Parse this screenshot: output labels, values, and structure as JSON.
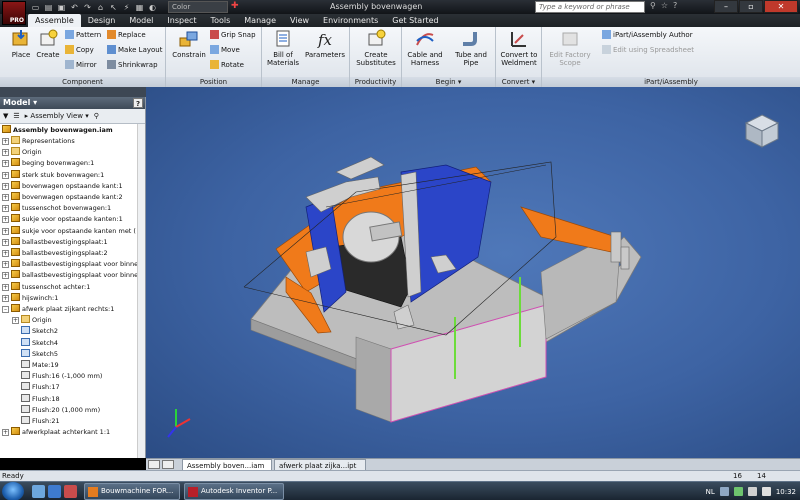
{
  "window": {
    "title": "Assembly bovenwagen",
    "logo_text": "PRO",
    "color_value": "Color",
    "help_search_placeholder": "Type a keyword or phrase",
    "controls": {
      "minimize": "–",
      "maximize": "▫",
      "close": "✕"
    }
  },
  "tabs": [
    "Assemble",
    "Design",
    "Model",
    "Inspect",
    "Tools",
    "Manage",
    "View",
    "Environments",
    "Get Started"
  ],
  "ribbon": {
    "panels": {
      "component": "Component",
      "position": "Position",
      "manage": "Manage",
      "productivity": "Productivity",
      "begin": "Begin ▾",
      "convert": "Convert ▾",
      "ipart": "iPart/iAssembly"
    },
    "buttons": {
      "place": "Place",
      "create": "Create",
      "pattern": "Pattern",
      "copy": "Copy",
      "mirror": "Mirror",
      "replace": "Replace",
      "make_layout": "Make Layout",
      "shrinkwrap": "Shrinkwrap",
      "constrain": "Constrain",
      "grip_snap": "Grip Snap",
      "move": "Move",
      "rotate": "Rotate",
      "bill_of_materials": "Bill of Materials",
      "parameters": "Parameters",
      "create_substitutes": "Create Substitutes",
      "cable_and_harness": "Cable and Harness",
      "tube_and_pipe": "Tube and Pipe",
      "convert_to_weldment": "Convert to Weldment",
      "edit_factory_scope": "Edit Factory Scope",
      "ipart_author": "iPart/iAssembly Author",
      "edit_spreadsheet": "Edit using Spreadsheet"
    }
  },
  "browser": {
    "title": "Model ▾",
    "help": "?",
    "view_label": "Assembly View",
    "root": "Assembly bovenwagen.iam",
    "items": [
      {
        "label": "Representations",
        "type": "folder",
        "indent": 1,
        "exp": "+"
      },
      {
        "label": "Origin",
        "type": "folder",
        "indent": 1,
        "exp": "+"
      },
      {
        "label": "beging bovenwagen:1",
        "type": "part",
        "indent": 1,
        "exp": "+"
      },
      {
        "label": "sterk stuk bovenwagen:1",
        "type": "part",
        "indent": 1,
        "exp": "+"
      },
      {
        "label": "bovenwagen opstaande kant:1",
        "type": "part",
        "indent": 1,
        "exp": "+"
      },
      {
        "label": "bovenwagen opstaande kant:2",
        "type": "part",
        "indent": 1,
        "exp": "+"
      },
      {
        "label": "tussenschot bovenwagen:1",
        "type": "part",
        "indent": 1,
        "exp": "+"
      },
      {
        "label": "sukje voor opstaande kanten:1",
        "type": "part",
        "indent": 1,
        "exp": "+"
      },
      {
        "label": "sukje voor opstaande kanten met (",
        "type": "part",
        "indent": 1,
        "exp": "+"
      },
      {
        "label": "ballastbevestigingsplaat:1",
        "type": "part",
        "indent": 1,
        "exp": "+"
      },
      {
        "label": "ballastbevestigingsplaat:2",
        "type": "part",
        "indent": 1,
        "exp": "+"
      },
      {
        "label": "ballastbevestigingsplaat voor binne",
        "type": "part",
        "indent": 1,
        "exp": "+"
      },
      {
        "label": "ballastbevestigingsplaat voor binne",
        "type": "part",
        "indent": 1,
        "exp": "+"
      },
      {
        "label": "tussenschot achter:1",
        "type": "part",
        "indent": 1,
        "exp": "+"
      },
      {
        "label": "hijswinch:1",
        "type": "part",
        "indent": 1,
        "exp": "+"
      },
      {
        "label": "afwerk plaat zijkant rechts:1",
        "type": "part",
        "indent": 1,
        "exp": "–"
      },
      {
        "label": "Origin",
        "type": "folder",
        "indent": 2,
        "exp": "+"
      },
      {
        "label": "Sketch2",
        "type": "sketch",
        "indent": 2,
        "exp": ""
      },
      {
        "label": "Sketch4",
        "type": "sketch",
        "indent": 2,
        "exp": ""
      },
      {
        "label": "Sketch5",
        "type": "sketch",
        "indent": 2,
        "exp": ""
      },
      {
        "label": "Mate:19",
        "type": "constraint",
        "indent": 2,
        "exp": ""
      },
      {
        "label": "Flush:16 (-1,000 mm)",
        "type": "constraint",
        "indent": 2,
        "exp": ""
      },
      {
        "label": "Flush:17",
        "type": "constraint",
        "indent": 2,
        "exp": ""
      },
      {
        "label": "Flush:18",
        "type": "constraint",
        "indent": 2,
        "exp": ""
      },
      {
        "label": "Flush:20 (1,000 mm)",
        "type": "constraint",
        "indent": 2,
        "exp": ""
      },
      {
        "label": "Flush:21",
        "type": "constraint",
        "indent": 2,
        "exp": ""
      },
      {
        "label": "afwerkplaat achterkant 1:1",
        "type": "part",
        "indent": 1,
        "exp": "+"
      }
    ]
  },
  "doc_tabs": [
    "Assembly boven...iam",
    "afwerk plaat zijka...ipt"
  ],
  "status": {
    "text": "Ready",
    "n1": "16",
    "n2": "14"
  },
  "taskbar": {
    "tasks": [
      "Bouwmachine FOR...",
      "Autodesk Inventor P..."
    ],
    "lang": "NL",
    "time": "10:32"
  },
  "colors": {
    "viewport_bg": "#3d63a3",
    "orange": "#f07a1a",
    "blue_part": "#2b45c8",
    "gray_part": "#c8c8c8",
    "accent_red": "#c0392b"
  }
}
